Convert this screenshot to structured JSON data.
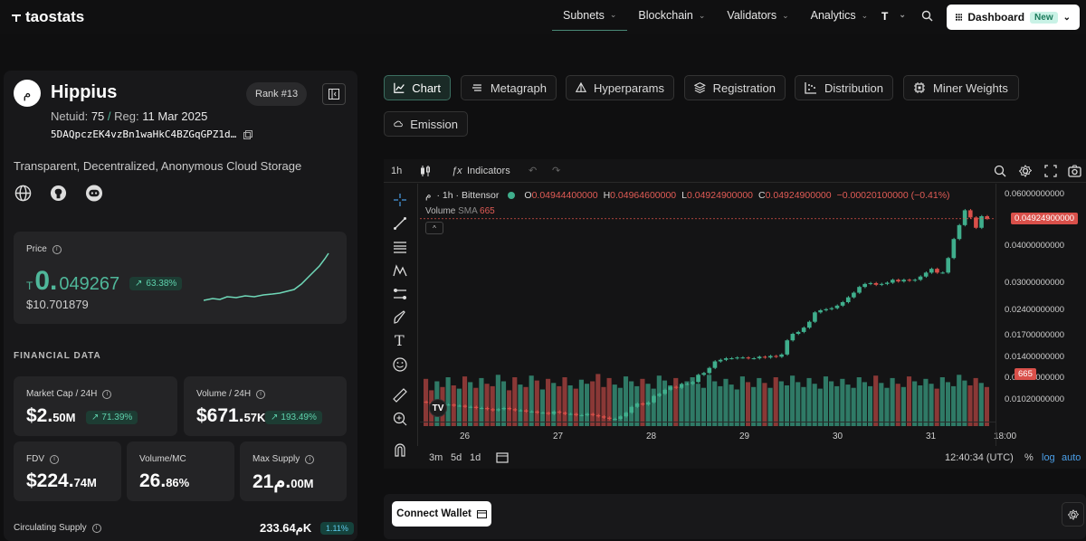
{
  "brand": {
    "name": "taostats"
  },
  "nav": [
    {
      "label": "Subnets",
      "active": true
    },
    {
      "label": "Blockchain",
      "active": false
    },
    {
      "label": "Validators",
      "active": false
    },
    {
      "label": "Analytics",
      "active": false
    }
  ],
  "currency_symbol": "T",
  "dashboard": {
    "label": "Dashboard",
    "badge": "New"
  },
  "subnet": {
    "avatar_glyph": "م",
    "name": "Hippius",
    "rank": "Rank #13",
    "netuid_label": "Netuid:",
    "netuid": "75",
    "reg_label": "Reg:",
    "reg_date": "11 Mar 2025",
    "hotkey": "5DAQpczEK4vzBn1waHkC4BZGqGPZ1d…",
    "description": "Transparent, Decentralized, Anonymous Cloud Storage"
  },
  "price": {
    "label": "Price",
    "symbol": "T",
    "int": "0.",
    "dec": "049267",
    "change": "63.38%",
    "usd": "$10.701879"
  },
  "financial": {
    "title": "FINANCIAL DATA",
    "market_cap": {
      "label": "Market Cap / 24H",
      "main": "$2.",
      "small": "50M",
      "change": "71.39%"
    },
    "volume": {
      "label": "Volume / 24H",
      "main": "$671.",
      "small": "57K",
      "change": "193.49%"
    },
    "fdv": {
      "label": "FDV",
      "main": "$224.",
      "small": "74M"
    },
    "vol_mc": {
      "label": "Volume/MC",
      "main": "26.",
      "small": "86%"
    },
    "max_supply": {
      "label": "Max Supply",
      "main": "م21.",
      "small": "00M"
    },
    "circ": {
      "label": "Circulating Supply",
      "value": "م233.64K",
      "pct": "1.11%"
    }
  },
  "tabs": [
    "Chart",
    "Metagraph",
    "Hyperparams",
    "Registration",
    "Distribution",
    "Miner Weights",
    "Emission"
  ],
  "chart_toolbar": {
    "interval": "1h",
    "indicators": "Indicators"
  },
  "chart_legend": {
    "symbol": "م",
    "title": "· 1h · Bittensor",
    "o": "0.04944400000",
    "h": "0.04964600000",
    "l": "0.04924900000",
    "c": "0.04924900000",
    "chg": "−0.00020100000 (−0.41%)",
    "vol_label": "Volume",
    "sma_label": "SMA",
    "vol_value": "665"
  },
  "chart_data": {
    "type": "candlestick",
    "y_ticks": [
      "0.06000000000",
      "0.04000000000",
      "0.03000000000",
      "0.02400000000",
      "0.01700000000",
      "0.01400000000",
      "0.01200000000",
      "0.01020000000"
    ],
    "x_ticks": [
      "26",
      "27",
      "28",
      "29",
      "30",
      "31",
      "18:00"
    ],
    "last_price": "0.04924900000",
    "last_volume": "665",
    "series_close": [
      0.0112,
      0.0111,
      0.0111,
      0.011,
      0.011,
      0.0109,
      0.0109,
      0.0108,
      0.0108,
      0.0107,
      0.0107,
      0.0106,
      0.0105,
      0.0106,
      0.0107,
      0.0106,
      0.0105,
      0.0105,
      0.0104,
      0.0104,
      0.0103,
      0.0103,
      0.0102,
      0.0104,
      0.0103,
      0.0102,
      0.0102,
      0.0101,
      0.0101,
      0.0102,
      0.0101,
      0.01,
      0.0099,
      0.0098,
      0.0098,
      0.01,
      0.0103,
      0.0108,
      0.0111,
      0.011,
      0.0112,
      0.0118,
      0.012,
      0.0124,
      0.0127,
      0.0126,
      0.013,
      0.013,
      0.0132,
      0.014,
      0.0142,
      0.0148,
      0.0156,
      0.0158,
      0.016,
      0.016,
      0.0161,
      0.0161,
      0.016,
      0.016,
      0.0162,
      0.0161,
      0.0163,
      0.0162,
      0.0165,
      0.0185,
      0.0195,
      0.0198,
      0.0205,
      0.0215,
      0.0232,
      0.0236,
      0.0238,
      0.024,
      0.0245,
      0.0252,
      0.0262,
      0.0272,
      0.0285,
      0.0292,
      0.0294,
      0.029,
      0.0292,
      0.0295,
      0.0302,
      0.0298,
      0.0302,
      0.03,
      0.0302,
      0.031,
      0.032,
      0.033,
      0.032,
      0.032,
      0.036,
      0.042,
      0.047,
      0.053,
      0.05,
      0.046,
      0.0505,
      0.0495
    ],
    "series_volume": [
      0.58,
      0.44,
      0.55,
      0.48,
      0.6,
      0.5,
      0.46,
      0.61,
      0.54,
      0.47,
      0.59,
      0.52,
      0.49,
      0.63,
      0.55,
      0.44,
      0.6,
      0.51,
      0.48,
      0.62,
      0.56,
      0.45,
      0.58,
      0.53,
      0.49,
      0.6,
      0.5,
      0.46,
      0.57,
      0.52,
      0.55,
      0.64,
      0.48,
      0.59,
      0.51,
      0.47,
      0.61,
      0.55,
      0.49,
      0.58,
      0.52,
      0.46,
      0.62,
      0.56,
      0.5,
      0.59,
      0.48,
      0.55,
      0.6,
      0.52,
      0.47,
      0.63,
      0.55,
      0.49,
      0.58,
      0.51,
      0.45,
      0.61,
      0.54,
      0.48,
      0.59,
      0.53,
      0.47,
      0.6,
      0.55,
      0.5,
      0.62,
      0.54,
      0.48,
      0.59,
      0.52,
      0.46,
      0.61,
      0.55,
      0.49,
      0.58,
      0.51,
      0.47,
      0.6,
      0.54,
      0.49,
      0.62,
      0.53,
      0.47,
      0.59,
      0.52,
      0.48,
      0.61,
      0.55,
      0.5,
      0.58,
      0.52,
      0.46,
      0.6,
      0.54,
      0.49,
      0.63,
      0.56,
      0.5,
      0.59,
      0.53,
      0.48
    ]
  },
  "chart_bottom": {
    "ranges": [
      "3m",
      "5d",
      "1d"
    ],
    "time": "12:40:34 (UTC)",
    "pct": "%",
    "log": "log",
    "auto": "auto"
  },
  "wallet": {
    "label": "Connect Wallet"
  },
  "colors": {
    "accent": "#4fb79a",
    "down": "#d9504a",
    "up": "#3fae8c"
  }
}
